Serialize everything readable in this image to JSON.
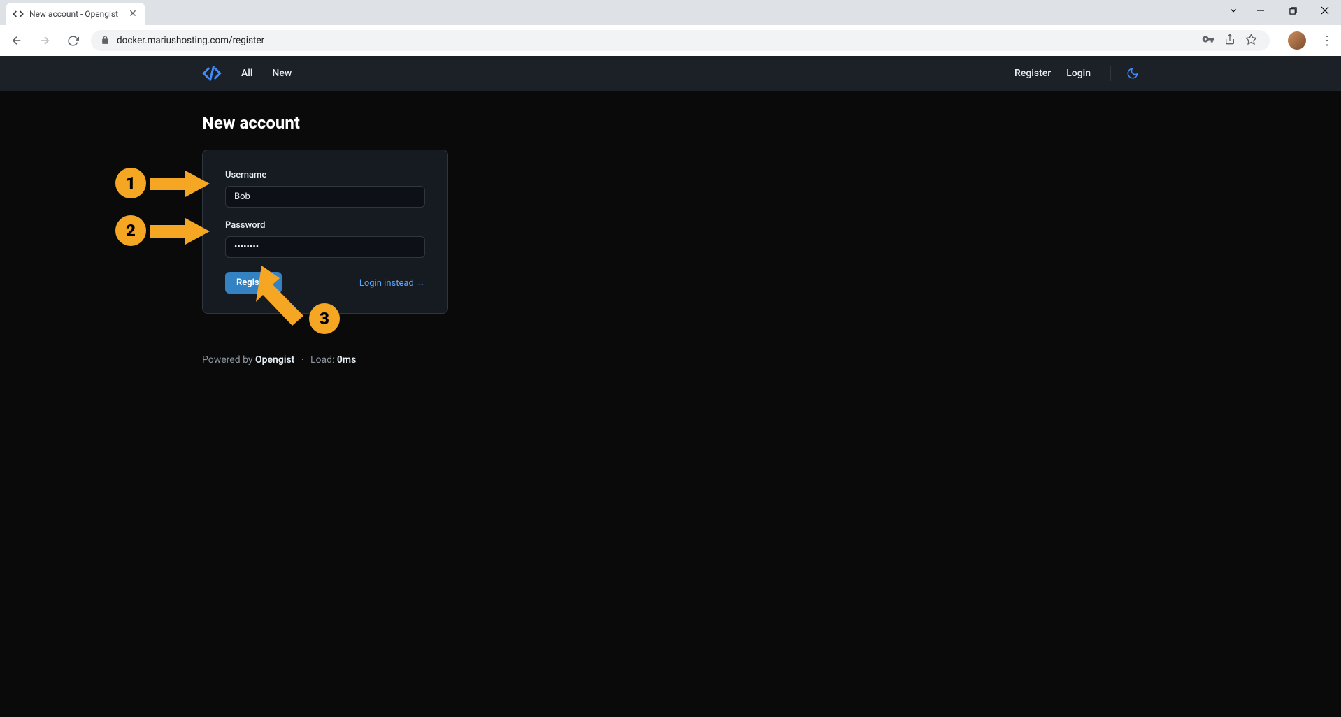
{
  "browser": {
    "tab_title": "New account - Opengist",
    "url": "docker.mariushosting.com/register"
  },
  "nav": {
    "all": "All",
    "new": "New",
    "register": "Register",
    "login": "Login"
  },
  "page": {
    "title": "New account"
  },
  "form": {
    "username_label": "Username",
    "username_value": "Bob",
    "password_label": "Password",
    "password_value": "••••••••",
    "register_button": "Register",
    "login_instead": "Login instead →"
  },
  "footer": {
    "powered_by": "Powered by ",
    "brand": "Opengist",
    "load_prefix": "Load: ",
    "load_value": "0ms"
  },
  "annotations": {
    "step1": "1",
    "step2": "2",
    "step3": "3"
  }
}
